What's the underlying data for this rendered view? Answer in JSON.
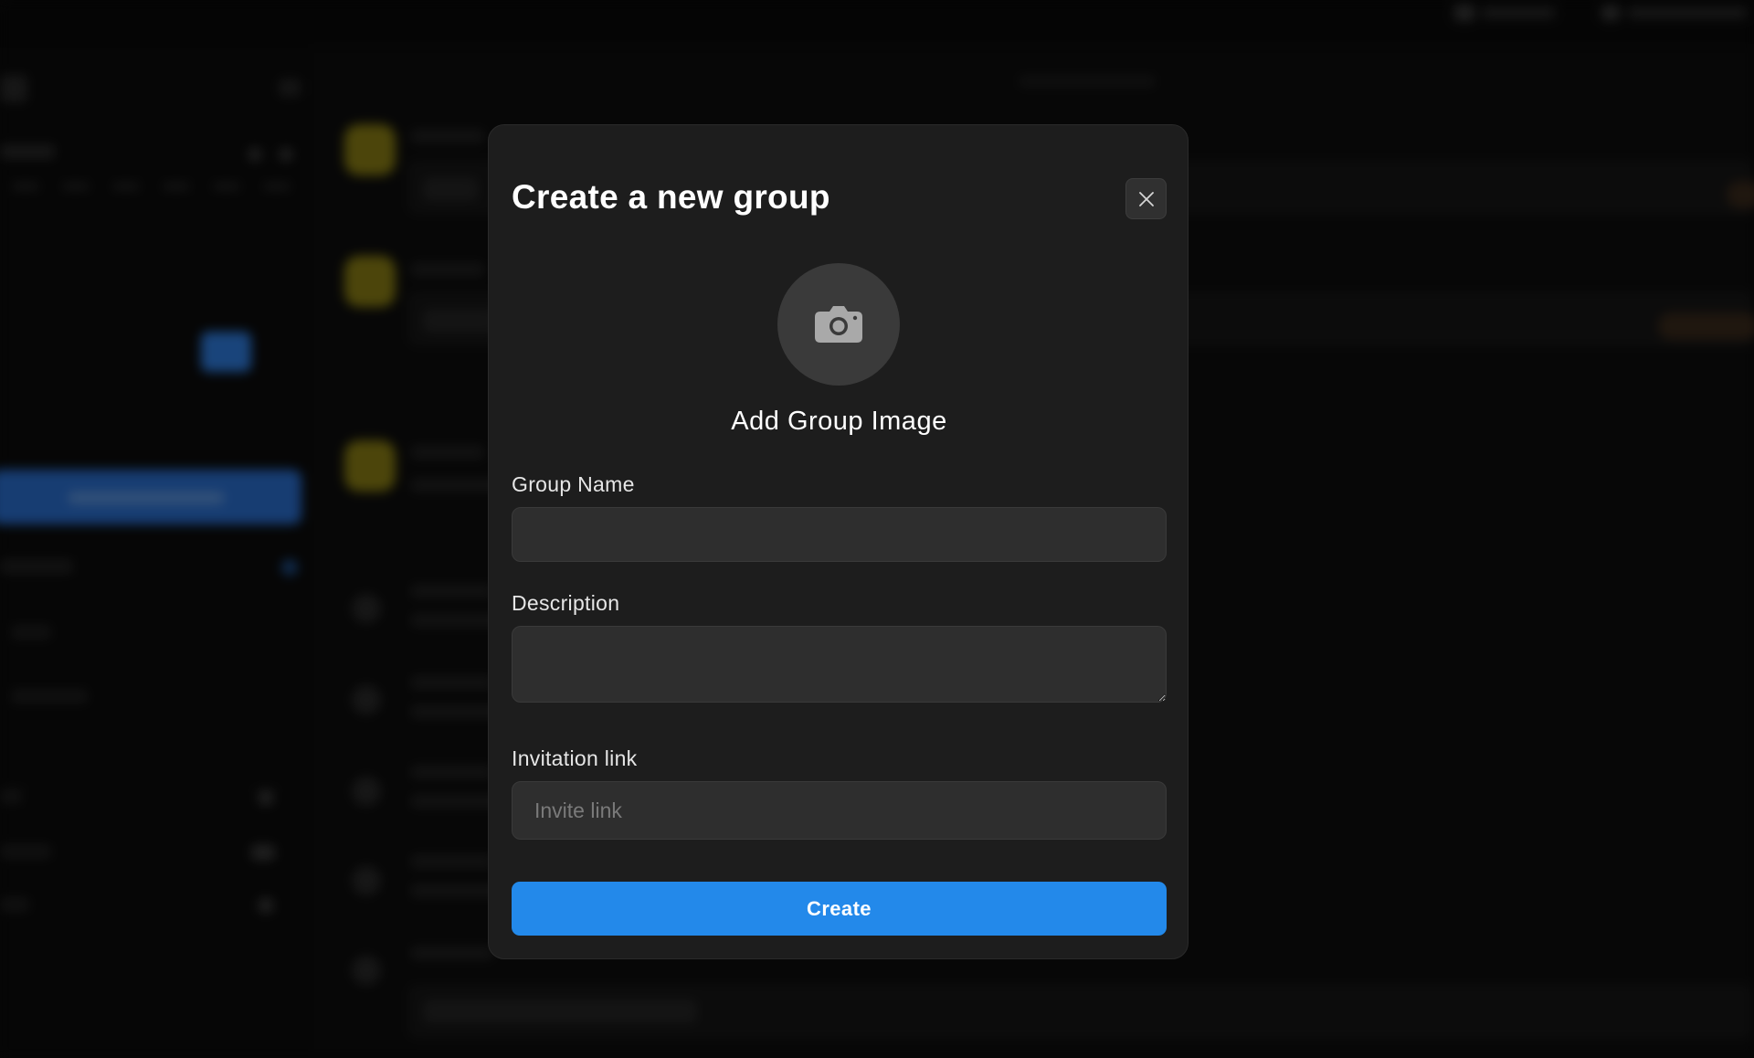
{
  "modal": {
    "title": "Create a new group",
    "add_image_label": "Add Group Image",
    "group_name": {
      "label": "Group Name",
      "value": "",
      "placeholder": ""
    },
    "description": {
      "label": "Description",
      "value": "",
      "placeholder": ""
    },
    "invitation": {
      "label": "Invitation link",
      "value": "",
      "placeholder": "Invite link"
    },
    "create_label": "Create",
    "icons": {
      "close": "close-icon",
      "camera": "camera-icon"
    }
  },
  "colors": {
    "accent": "#2389ea",
    "modal_bg": "#1d1d1d",
    "input_bg": "#2e2e2e",
    "page_bg": "#0b0b0b"
  }
}
